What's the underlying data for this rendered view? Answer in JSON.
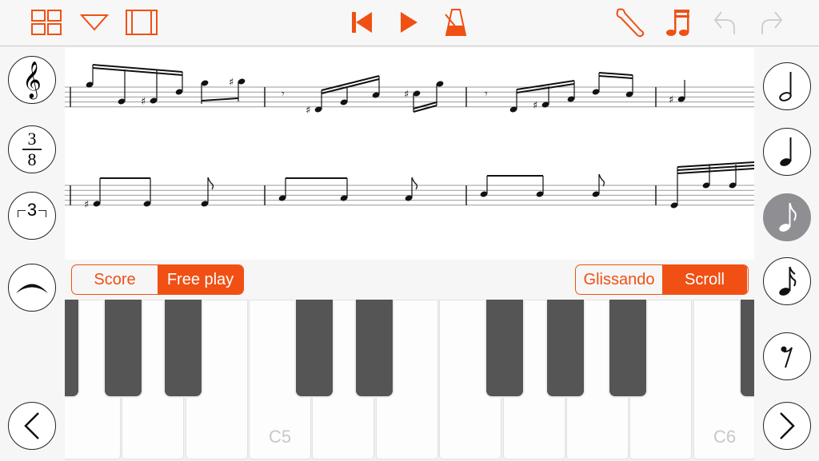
{
  "toolbar": {
    "icons": [
      "grid-icon",
      "dropdown-triangle-icon",
      "panel-icon",
      "skip-back-icon",
      "play-icon",
      "metronome-icon",
      "wrench-icon",
      "music-note-icon",
      "undo-icon",
      "redo-icon"
    ]
  },
  "left_sidebar": {
    "time_signature": {
      "top": "3",
      "bottom": "8"
    },
    "tuplet": "3",
    "icons": [
      "treble-clef-icon",
      "time-signature-icon",
      "triplet-icon",
      "slur-icon",
      "chevron-left-icon"
    ]
  },
  "right_sidebar": {
    "icons": [
      "half-note-icon",
      "quarter-note-icon",
      "eighth-note-icon",
      "sixteenth-note-icon",
      "eighth-rest-icon",
      "chevron-right-icon"
    ],
    "selected": "eighth-note-icon"
  },
  "mode_toggle": {
    "options": [
      "Score",
      "Free play"
    ],
    "selected": "Free play"
  },
  "scroll_toggle": {
    "options": [
      "Glissando",
      "Scroll"
    ],
    "selected": "Scroll"
  },
  "keyboard": {
    "labels": {
      "c5": "C5",
      "c6": "C6"
    }
  },
  "colors": {
    "accent": "#f05014",
    "disabled": "#cfcfcf",
    "black_key": "#555555",
    "selected_circle": "#8e8e93"
  }
}
